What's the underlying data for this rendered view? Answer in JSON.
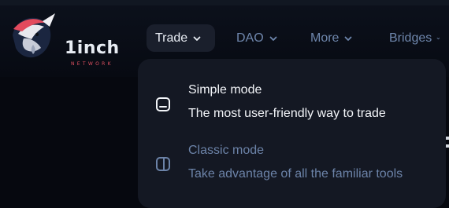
{
  "brand": {
    "name": "1inch",
    "tagline": "NETWORK"
  },
  "nav": {
    "items": [
      {
        "label": "Trade",
        "active": true
      },
      {
        "label": "DAO",
        "active": false
      },
      {
        "label": "More",
        "active": false
      },
      {
        "label": "Bridges",
        "active": false
      }
    ]
  },
  "trade_menu": {
    "items": [
      {
        "title": "Simple mode",
        "description": "The most user-friendly way to trade",
        "icon": "simple-mode-icon"
      },
      {
        "title": "Classic mode",
        "description": "Take advantage of all the familiar tools",
        "icon": "classic-mode-icon"
      }
    ]
  },
  "colors": {
    "background": "#06080f",
    "active_tab": "#1a1f2c",
    "menu_bg": "#141823",
    "muted_text": "#6f87ad",
    "brand_red": "#e05161"
  }
}
